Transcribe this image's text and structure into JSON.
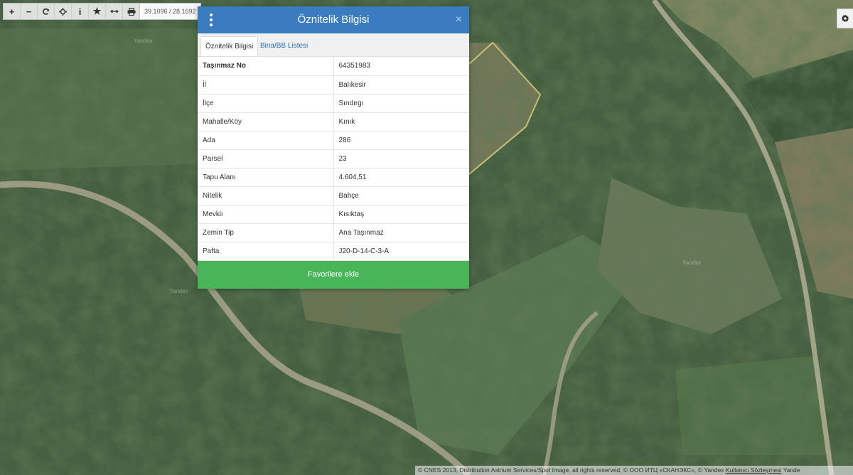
{
  "toolbar": {
    "buttons": [
      {
        "icon": "zoom-in-icon",
        "glyph": "+"
      },
      {
        "icon": "zoom-out-icon",
        "glyph": "−"
      },
      {
        "icon": "refresh-icon",
        "glyph": ""
      },
      {
        "icon": "locate-icon",
        "glyph": ""
      },
      {
        "icon": "info-icon",
        "glyph": "i"
      },
      {
        "icon": "star-icon",
        "glyph": "★"
      },
      {
        "icon": "measure-icon",
        "glyph": ""
      },
      {
        "icon": "print-icon",
        "glyph": ""
      }
    ],
    "coordinates": "39.1096 / 28.1692"
  },
  "settings": {
    "icon": "gear-icon"
  },
  "popup": {
    "title": "Öznitelik Bilgisi",
    "close_glyph": "×",
    "tabs": [
      {
        "label": "Öznitelik Bilgisi",
        "active": true
      },
      {
        "label": "Bina/BB Listesi",
        "active": false
      }
    ],
    "rows": [
      {
        "key": "Taşınmaz No",
        "value": "64351983"
      },
      {
        "key": "İl",
        "value": "Balıkesir"
      },
      {
        "key": "İlçe",
        "value": "Sındırgı"
      },
      {
        "key": "Mahalle/Köy",
        "value": "Kınık"
      },
      {
        "key": "Ada",
        "value": "286"
      },
      {
        "key": "Parsel",
        "value": "23"
      },
      {
        "key": "Tapu Alanı",
        "value": "4.604,51"
      },
      {
        "key": "Nitelik",
        "value": "Bahçe"
      },
      {
        "key": "Mevkii",
        "value": "Kısıktaş"
      },
      {
        "key": "Zemin Tip",
        "value": "Ana Taşınmaz"
      },
      {
        "key": "Pafta",
        "value": "J20-D-14-C-3-A"
      }
    ],
    "favorite_label": "Favorilere ekle"
  },
  "map_labels": {
    "watermark": "Yandex"
  },
  "attribution": {
    "text": "© CNES 2013, Distribution Astrium Services/Spot Image, all rights reserved, © ООО ИТЦ «СКАНЭКС», © Yandex",
    "link": "Kullanıcı Sözleşmesi",
    "tail": "Yande"
  },
  "colors": {
    "header": "#3b7cc0",
    "favorite_button": "#48b558",
    "parcel_outline": "#c9bf74"
  }
}
